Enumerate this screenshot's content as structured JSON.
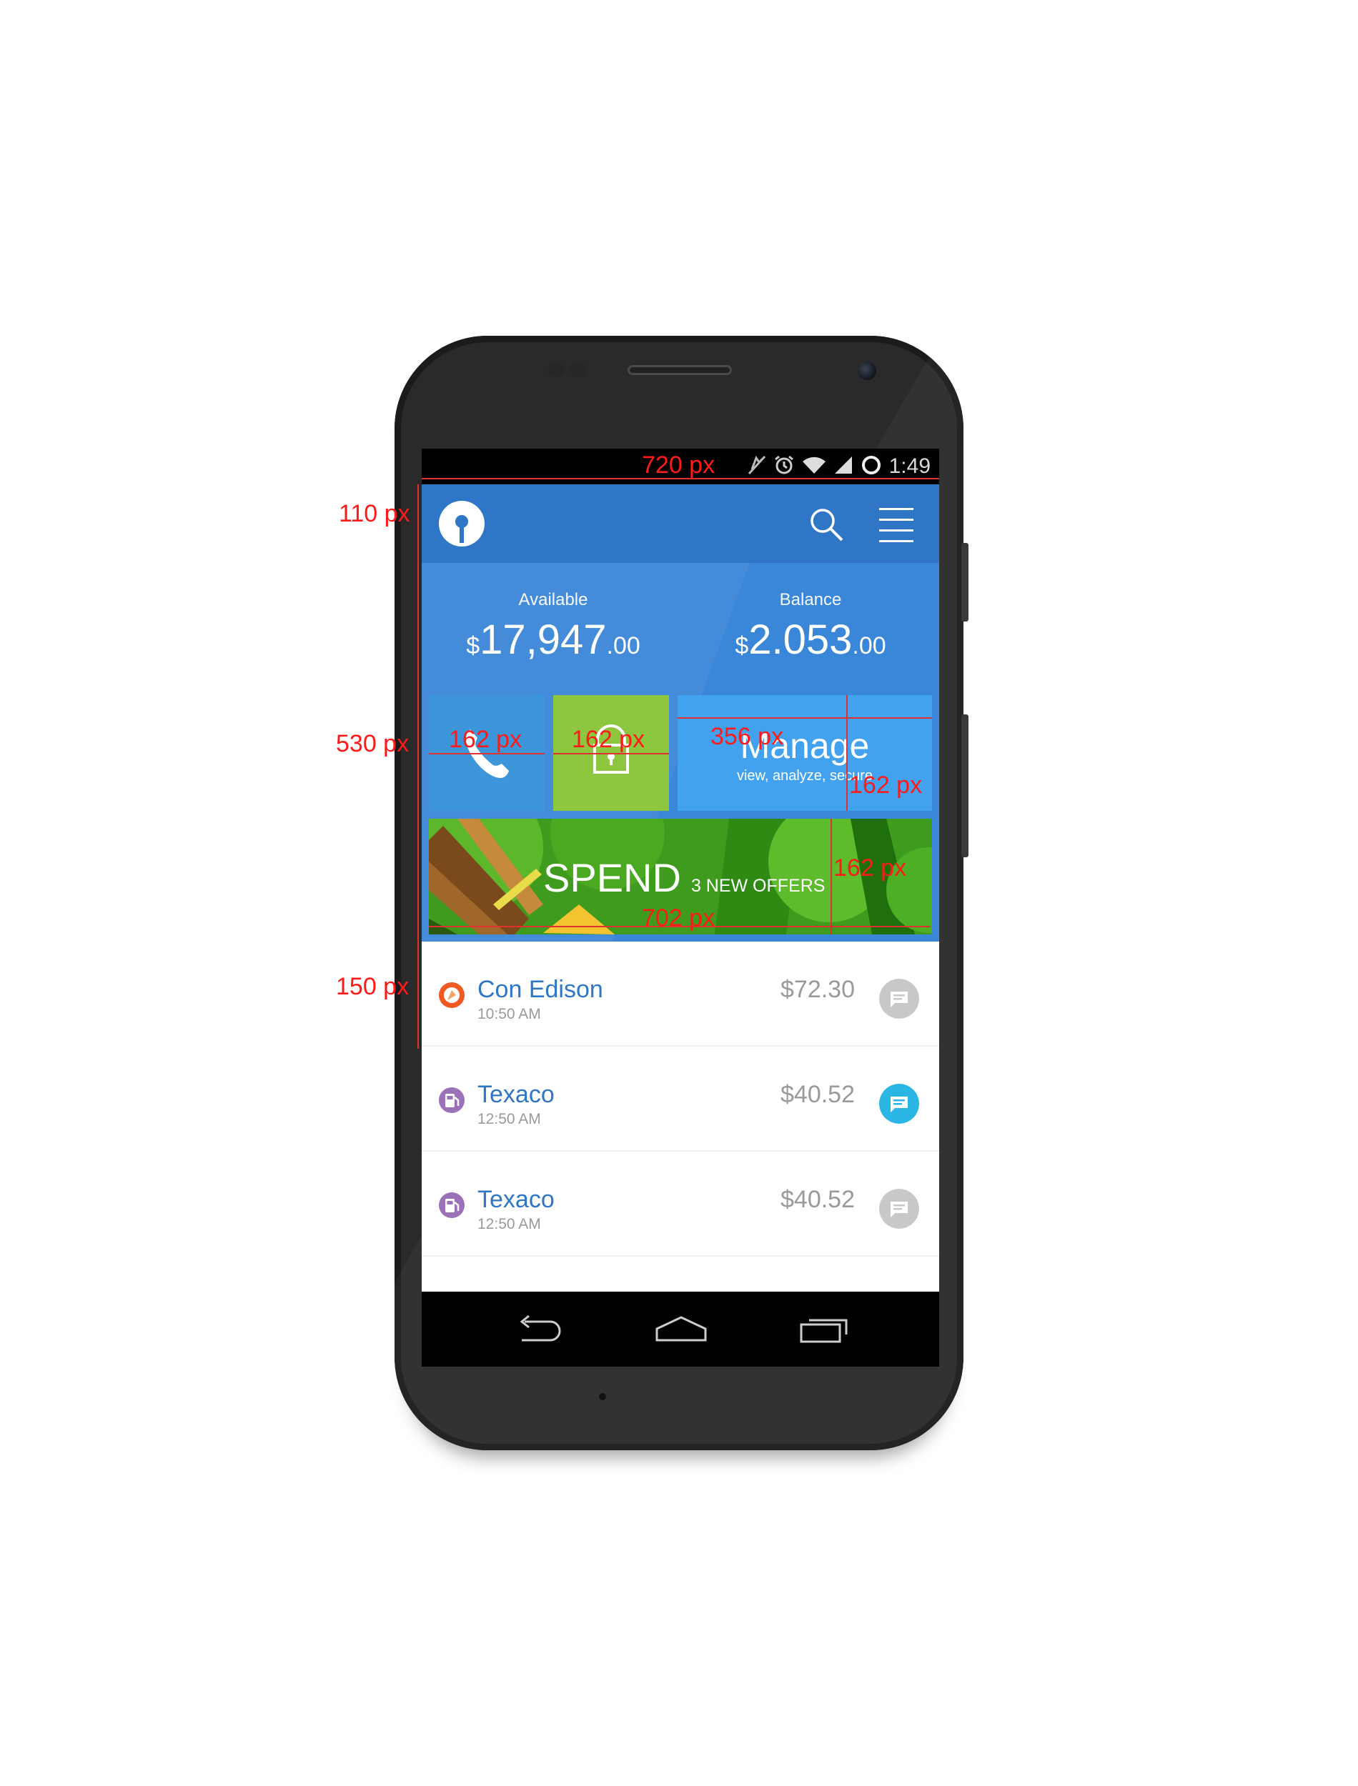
{
  "status_bar": {
    "time": "1:49",
    "icons": [
      "mute-icon",
      "alarm-icon",
      "wifi-icon",
      "signal-icon",
      "battery-ring-icon"
    ]
  },
  "app_bar": {
    "logo": "bank-logo-icon",
    "actions": [
      "search-icon",
      "menu-icon"
    ]
  },
  "balances": {
    "available": {
      "label": "Available",
      "currency": "$",
      "whole": "17,947",
      "decimal": ".00"
    },
    "balance": {
      "label": "Balance",
      "currency": "$",
      "whole": "2.053",
      "decimal": ".00"
    }
  },
  "tiles": {
    "phone_icon": "phone-icon",
    "lock_icon": "lock-icon",
    "manage": {
      "title": "Manage",
      "subtitle": "view, analyze, secure"
    },
    "spend": {
      "title": "SPEND",
      "subtitle": "3 NEW OFFERS"
    }
  },
  "transactions": [
    {
      "merchant": "Con Edison",
      "time": "10:50 AM",
      "amount": "$72.30",
      "icon": "utility-icon",
      "chat_active": false
    },
    {
      "merchant": "Texaco",
      "time": "12:50 AM",
      "amount": "$40.52",
      "icon": "fuel-pump-icon",
      "chat_active": true
    },
    {
      "merchant": "Texaco",
      "time": "12:50 AM",
      "amount": "$40.52",
      "icon": "fuel-pump-icon",
      "chat_active": false
    }
  ],
  "nav_bar": [
    "back-icon",
    "home-icon",
    "recents-icon"
  ],
  "annotations": {
    "screen_width": "720 px",
    "app_bar_height": "110 px",
    "hero_height": "530 px",
    "row_height": "150 px",
    "tile_phone_width": "162 px",
    "tile_lock_width": "162 px",
    "tile_manage_width": "356 px",
    "tile_manage_height": "162 px",
    "tile_spend_height": "162 px",
    "tile_spend_width": "702 px"
  },
  "colors": {
    "app_bar": "#2f76c7",
    "hero": "#3a86d8",
    "tile_phone": "#3d96d9",
    "tile_lock": "#8dc63f",
    "tile_manage": "#43a2ef",
    "tile_spend": "#3f9b1d",
    "link_text": "#2f76c7",
    "chat_active": "#29b6e5",
    "chat_inactive": "#c8c8c8",
    "annotation": "#ff1a1a"
  }
}
